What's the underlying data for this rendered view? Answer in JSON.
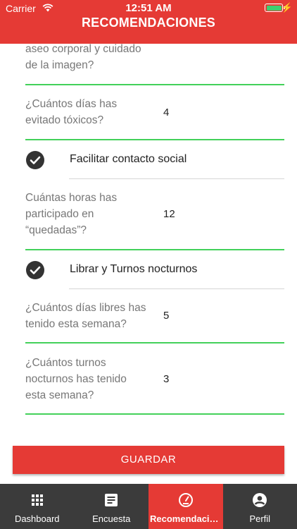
{
  "status_bar": {
    "carrier": "Carrier",
    "time": "12:51 AM",
    "battery_color": "#3cd070"
  },
  "header": {
    "title": "RECOMENDACIONES",
    "color": "#e53a35"
  },
  "questions": [
    {
      "label_lines": [
        "aseo corporal y cuidado",
        "de la imagen?"
      ],
      "value": ""
    },
    {
      "label_lines": [
        "¿Cuántos días has",
        "evitado tóxicos?"
      ],
      "value": "4"
    },
    {
      "label_lines": [
        "Cuántas horas has",
        "participado en",
        "“quedadas”?"
      ],
      "value": "12"
    },
    {
      "label_lines": [
        "¿Cuántos días libres has",
        "tenido esta semana?"
      ],
      "value": "5"
    },
    {
      "label_lines": [
        "¿Cuántos turnos",
        "nocturnos has tenido",
        "esta semana?"
      ],
      "value": "3"
    }
  ],
  "sections": [
    {
      "title": "Facilitar contacto social",
      "icon": "check-circle-icon"
    },
    {
      "title": "Librar y Turnos nocturnos",
      "icon": "check-circle-icon"
    }
  ],
  "save_button": {
    "label": "GUARDAR"
  },
  "tabbar": {
    "tabs": [
      {
        "label": "Dashboard",
        "icon": "grid-icon",
        "active": false
      },
      {
        "label": "Encuesta",
        "icon": "document-icon",
        "active": false
      },
      {
        "label": "Recomendacio...",
        "icon": "speedometer-icon",
        "active": true
      },
      {
        "label": "Perfil",
        "icon": "person-icon",
        "active": false
      }
    ]
  },
  "colors": {
    "accent": "#e53a35",
    "divider_green": "#43d15a",
    "tabbar_bg": "#3b3b3b"
  }
}
